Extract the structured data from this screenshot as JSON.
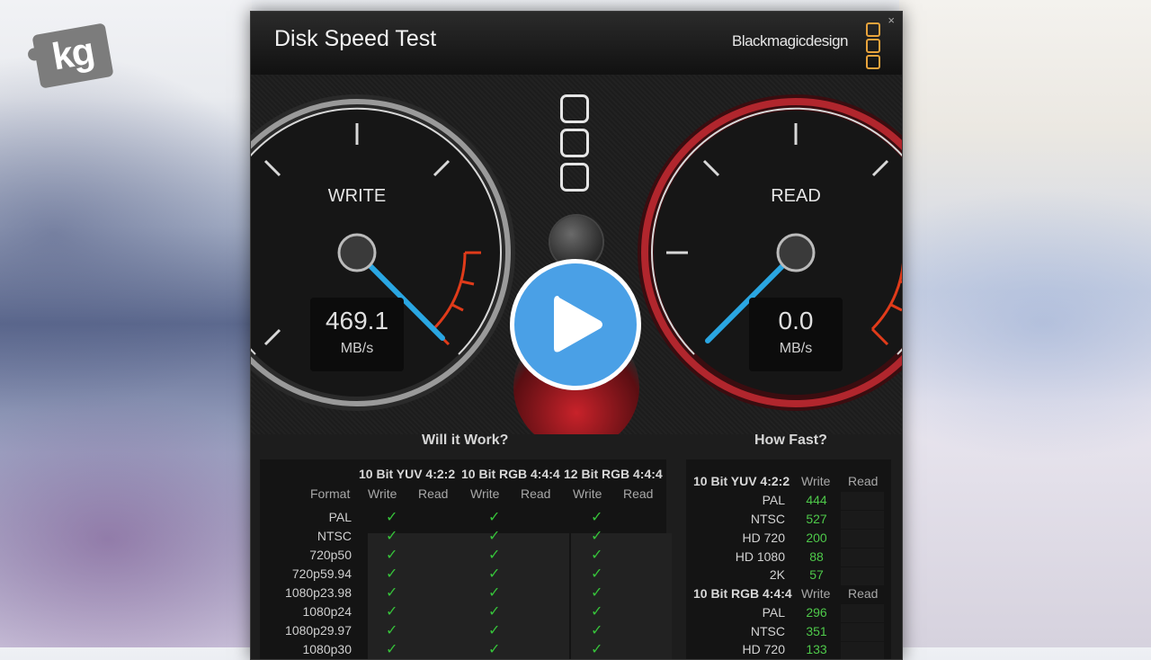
{
  "overlay": {
    "logo_text": "kg"
  },
  "window": {
    "title": "Disk Speed Test",
    "brand": "Blackmagicdesign",
    "close_glyph": "×"
  },
  "gauges": {
    "write": {
      "label": "WRITE",
      "value": "469.1",
      "unit": "MB/s"
    },
    "read": {
      "label": "READ",
      "value": "0.0",
      "unit": "MB/s"
    }
  },
  "will_it_work": {
    "title": "Will it Work?",
    "format_header": "Format",
    "groups": [
      {
        "name": "10 Bit YUV 4:2:2",
        "write": "Write",
        "read": "Read"
      },
      {
        "name": "10 Bit RGB 4:4:4",
        "write": "Write",
        "read": "Read"
      },
      {
        "name": "12 Bit RGB 4:4:4",
        "write": "Write",
        "read": "Read"
      }
    ],
    "formats": [
      "PAL",
      "NTSC",
      "720p50",
      "720p59.94",
      "1080p23.98",
      "1080p24",
      "1080p29.97",
      "1080p30"
    ],
    "check_glyph": "✓"
  },
  "how_fast": {
    "title": "How Fast?",
    "sections": [
      {
        "name": "10 Bit YUV 4:2:2",
        "write": "Write",
        "read": "Read",
        "rows": [
          {
            "label": "PAL",
            "write": "444"
          },
          {
            "label": "NTSC",
            "write": "527"
          },
          {
            "label": "HD 720",
            "write": "200"
          },
          {
            "label": "HD 1080",
            "write": "88"
          },
          {
            "label": "2K",
            "write": "57"
          }
        ]
      },
      {
        "name": "10 Bit RGB 4:4:4",
        "write": "Write",
        "read": "Read",
        "rows": [
          {
            "label": "PAL",
            "write": "296"
          },
          {
            "label": "NTSC",
            "write": "351"
          },
          {
            "label": "HD 720",
            "write": "133"
          }
        ]
      }
    ]
  }
}
